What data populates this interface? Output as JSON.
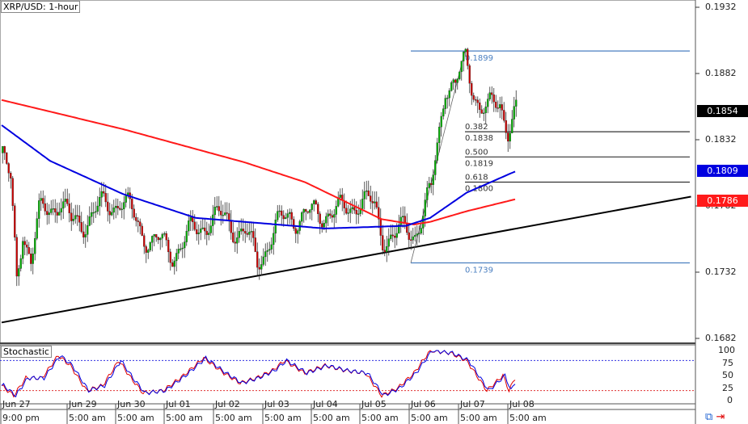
{
  "header": {
    "title": "XRP/USD: 1-hour"
  },
  "indicator": {
    "label": "Stochastic",
    "levels": [
      80,
      20
    ],
    "axis": [
      "100",
      "75",
      "50",
      "25",
      "0"
    ]
  },
  "colors": {
    "up": "#00b000",
    "down": "#d00000",
    "ma_fast": "#0000e0",
    "ma_slow": "#ff1a1a",
    "fib": "#4a7fc0",
    "trend": "#000000"
  },
  "price_axis": {
    "labels": [
      "0.1932",
      "0.1882",
      "0.1832",
      "0.1782",
      "0.1732",
      "0.1682"
    ],
    "badges": [
      {
        "value": "0.1854",
        "color": "#000000"
      },
      {
        "value": "0.1809",
        "color": "#0000e0"
      },
      {
        "value": "0.1786",
        "color": "#ff1a1a"
      }
    ]
  },
  "time_axis": {
    "dates": [
      "Jun 27",
      "Jun 29",
      "Jun 30",
      "Jul 01",
      "Jul 02",
      "Jul 03",
      "Jul 04",
      "Jul 05",
      "Jul 06",
      "Jul 07",
      "Jul 08"
    ],
    "times": [
      "9:00 pm",
      "5:00 am",
      "5:00 am",
      "5:00 am",
      "5:00 am",
      "5:00 am",
      "5:00 am",
      "5:00 am",
      "5:00 am",
      "5:00 am",
      "5:00 am"
    ]
  },
  "fib": {
    "levels": [
      {
        "ratio": "",
        "price": "0.1899"
      },
      {
        "ratio": "0.382",
        "price": "0.1838"
      },
      {
        "ratio": "0.500",
        "price": "0.1819"
      },
      {
        "ratio": "0.618",
        "price": "0.1800"
      },
      {
        "ratio": "",
        "price": "0.1739"
      }
    ]
  },
  "chart_data": {
    "type": "candlestick",
    "title": "XRP/USD: 1-hour",
    "ylim": [
      0.1682,
      0.1932
    ],
    "close_path": [
      [
        0,
        0.1822
      ],
      [
        4,
        0.1797
      ],
      [
        7,
        0.1724
      ],
      [
        10,
        0.1767
      ],
      [
        14,
        0.1742
      ],
      [
        18,
        0.1773
      ],
      [
        28,
        0.1788
      ],
      [
        34,
        0.1767
      ],
      [
        38,
        0.177
      ],
      [
        48,
        0.1779
      ],
      [
        58,
        0.1788
      ],
      [
        66,
        0.177
      ],
      [
        74,
        0.1755
      ],
      [
        84,
        0.1748
      ],
      [
        94,
        0.1761
      ],
      [
        102,
        0.1773
      ],
      [
        112,
        0.177
      ],
      [
        120,
        0.1761
      ],
      [
        126,
        0.1739
      ],
      [
        132,
        0.1758
      ],
      [
        142,
        0.1776
      ],
      [
        150,
        0.1773
      ],
      [
        160,
        0.1779
      ],
      [
        168,
        0.1776
      ],
      [
        176,
        0.1788
      ],
      [
        184,
        0.1779
      ],
      [
        188,
        0.1761
      ],
      [
        194,
        0.1758
      ],
      [
        200,
        0.1764
      ],
      [
        204,
        0.1764
      ],
      [
        208,
        0.1776
      ],
      [
        212,
        0.1791
      ],
      [
        216,
        0.184
      ],
      [
        219,
        0.1877
      ],
      [
        224,
        0.187
      ],
      [
        229,
        0.1892
      ],
      [
        232,
        0.1877
      ],
      [
        236,
        0.1858
      ],
      [
        240,
        0.1852
      ],
      [
        246,
        0.1861
      ],
      [
        250,
        0.1843
      ],
      [
        254,
        0.1852
      ]
    ],
    "ma_slow": [
      [
        0,
        0.1862
      ],
      [
        60,
        0.184
      ],
      [
        120,
        0.1815
      ],
      [
        150,
        0.18
      ],
      [
        188,
        0.1772
      ],
      [
        204,
        0.1768
      ],
      [
        212,
        0.177
      ],
      [
        230,
        0.1778
      ],
      [
        254,
        0.1787
      ]
    ],
    "ma_fast": [
      [
        0,
        0.1843
      ],
      [
        24,
        0.1816
      ],
      [
        60,
        0.1791
      ],
      [
        96,
        0.1773
      ],
      [
        160,
        0.1765
      ],
      [
        200,
        0.1767
      ],
      [
        212,
        0.1773
      ],
      [
        230,
        0.1792
      ],
      [
        254,
        0.1808
      ]
    ],
    "trendline": [
      [
        0,
        0.1694
      ],
      [
        341,
        0.1789
      ]
    ],
    "stochastic": [
      [
        0,
        30
      ],
      [
        6,
        10
      ],
      [
        12,
        45
      ],
      [
        20,
        45
      ],
      [
        28,
        90
      ],
      [
        34,
        70
      ],
      [
        42,
        20
      ],
      [
        50,
        30
      ],
      [
        58,
        80
      ],
      [
        64,
        45
      ],
      [
        70,
        15
      ],
      [
        80,
        20
      ],
      [
        90,
        50
      ],
      [
        100,
        85
      ],
      [
        110,
        55
      ],
      [
        118,
        35
      ],
      [
        126,
        45
      ],
      [
        134,
        60
      ],
      [
        140,
        80
      ],
      [
        150,
        55
      ],
      [
        160,
        70
      ],
      [
        170,
        60
      ],
      [
        180,
        55
      ],
      [
        188,
        10
      ],
      [
        196,
        25
      ],
      [
        204,
        55
      ],
      [
        212,
        100
      ],
      [
        222,
        95
      ],
      [
        230,
        80
      ],
      [
        240,
        20
      ],
      [
        248,
        50
      ],
      [
        251,
        20
      ],
      [
        254,
        45
      ]
    ]
  }
}
